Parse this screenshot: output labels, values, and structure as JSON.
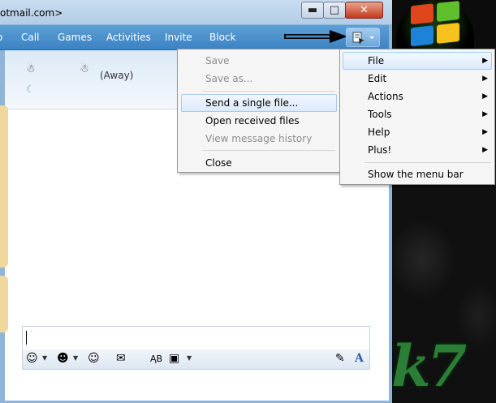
{
  "window": {
    "title": "otmail.com>",
    "controls": {
      "minimize": "▬",
      "maximize": "□",
      "close": "✕"
    }
  },
  "toolbar": {
    "items": [
      "Call",
      "Games",
      "Activities",
      "Invite",
      "Block"
    ]
  },
  "contact": {
    "status": "(Away)"
  },
  "file_menu": {
    "items": [
      {
        "label": "Save",
        "enabled": false
      },
      {
        "label": "Save as...",
        "enabled": false
      },
      {
        "label": "Send a single file...",
        "enabled": true,
        "highlighted": true
      },
      {
        "label": "Open received files",
        "enabled": true
      },
      {
        "label": "View message history",
        "enabled": false
      },
      {
        "label": "Close",
        "enabled": true
      }
    ]
  },
  "main_menu": {
    "items": [
      {
        "label": "File",
        "submenu": true,
        "highlighted": true
      },
      {
        "label": "Edit",
        "submenu": true
      },
      {
        "label": "Actions",
        "submenu": true
      },
      {
        "label": "Tools",
        "submenu": true
      },
      {
        "label": "Help",
        "submenu": true
      },
      {
        "label": "Plus!",
        "submenu": true
      },
      {
        "label": "Show the menu bar",
        "submenu": false
      }
    ]
  },
  "format_bar": {
    "icons": [
      "emoticon-icon",
      "wink-icon",
      "nudge-icon",
      "voice-clip-icon",
      "font-style-icon",
      "background-icon",
      "handwriting-icon",
      "font-icon"
    ]
  },
  "colors": {
    "toolbar": "#3c82c2",
    "highlight_border": "#a8cbee"
  }
}
